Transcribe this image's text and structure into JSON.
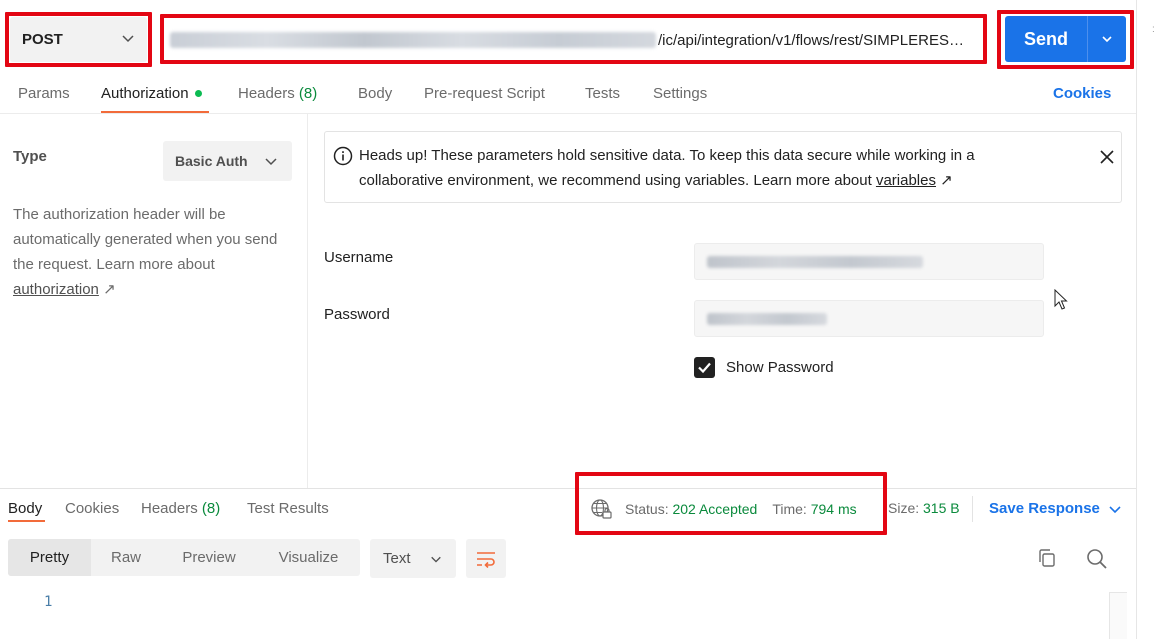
{
  "request": {
    "method": "POST",
    "url_visible": "/ic/api/integration/v1/flows/rest/SIMPLERES…",
    "send_label": "Send"
  },
  "request_tabs": {
    "params": "Params",
    "authorization": "Authorization",
    "headers": "Headers",
    "headers_count": "(8)",
    "body": "Body",
    "prerequest": "Pre-request Script",
    "tests": "Tests",
    "settings": "Settings",
    "cookies": "Cookies"
  },
  "auth": {
    "type_label": "Type",
    "type_value": "Basic Auth",
    "description": "The authorization header will be automatically generated when you send the request. Learn more about",
    "description_link": "authorization",
    "link_arrow": "↗"
  },
  "banner": {
    "text": "Heads up! These parameters hold sensitive data. To keep this data secure while working in a collaborative environment, we recommend using variables. Learn more about",
    "link": "variables",
    "arrow": "↗"
  },
  "form": {
    "username_label": "Username",
    "password_label": "Password",
    "show_password_label": "Show Password",
    "show_password_checked": true
  },
  "response_tabs": {
    "body": "Body",
    "cookies": "Cookies",
    "headers": "Headers",
    "headers_count": "(8)",
    "test_results": "Test Results"
  },
  "response_meta": {
    "status_label": "Status:",
    "status_value": "202 Accepted",
    "time_label": "Time:",
    "time_value": "794 ms",
    "size_label": "Size:",
    "size_value": "315 B",
    "save_response": "Save Response"
  },
  "body_view": {
    "modes": [
      "Pretty",
      "Raw",
      "Preview",
      "Visualize"
    ],
    "format": "Text",
    "line_number": "1"
  },
  "colors": {
    "accent_blue": "#1a73e8",
    "highlight_red": "#e30613",
    "tab_orange": "#f26b3a",
    "status_green": "#0a8a3c"
  },
  "icons": [
    "chevron-down-icon",
    "info-icon",
    "close-icon",
    "external-link-icon",
    "checkmark-icon",
    "globe-lock-icon",
    "wrap-lines-icon",
    "copy-icon",
    "search-icon",
    "mouse-cursor-icon"
  ]
}
